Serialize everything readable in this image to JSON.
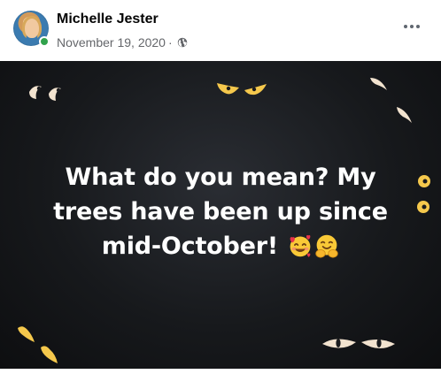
{
  "post": {
    "author": "Michelle Jester",
    "date": "November 19, 2020",
    "separator": "·",
    "privacy_icon": "globe-icon",
    "more_icon": "more-options-icon",
    "online_status_color": "#31a24c",
    "image": {
      "text": "What do you mean? My trees have been up since mid-October!",
      "emojis": [
        "smiling-face-with-hearts-emoji",
        "hugging-face-emoji"
      ],
      "background_color": "#17191c",
      "eye_color": "#f5d76e",
      "text_color": "#ffffff"
    }
  }
}
